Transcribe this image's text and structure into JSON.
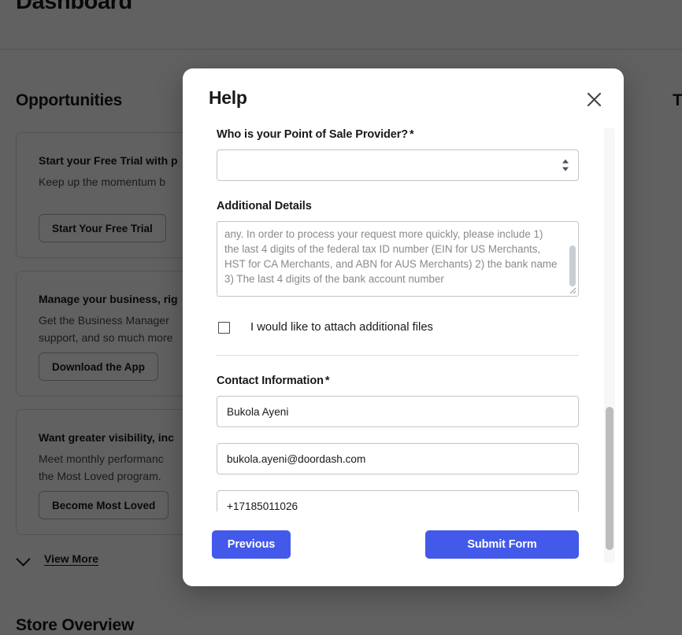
{
  "background": {
    "page_title": "Dashboard",
    "opportunities_heading": "Opportunities",
    "right_column_heading": "T",
    "store_overview_heading": "Store Overview",
    "view_more_label": "View More",
    "cards": [
      {
        "title": "Start your Free Trial with p",
        "description": "Keep up the momentum b",
        "button": "Start Your Free Trial"
      },
      {
        "title": "Manage your business, rig",
        "description": "Get the Business Manager\nsupport, and so much more",
        "button": "Download the App"
      },
      {
        "title": "Want greater visibility, inc",
        "description": "Meet monthly performanc\nthe Most Loved program.",
        "button": "Become Most Loved"
      }
    ]
  },
  "modal": {
    "title": "Help",
    "close_label": "×",
    "fields": {
      "pos_provider": {
        "label": "Who is your Point of Sale Provider?",
        "required_marker": "*",
        "value": "",
        "options": []
      },
      "additional_details": {
        "label": "Additional Details",
        "value": "any. In order to process your request more quickly, please include 1) the last 4 digits of the federal tax ID number (EIN for US Merchants, HST for CA Merchants, and ABN for AUS Merchants) 2) the bank name 3) The last 4 digits of the bank account number"
      },
      "attach_files": {
        "label": "I would like to attach additional files",
        "checked": false
      },
      "contact_information": {
        "label": "Contact Information",
        "required_marker": "*",
        "name": "Bukola Ayeni",
        "email": "bukola.ayeni@doordash.com",
        "phone": "+17185011026"
      }
    },
    "footer": {
      "previous_label": "Previous",
      "submit_label": "Submit Form"
    }
  },
  "colors": {
    "primary_blue": "#4259E9",
    "text_dark": "#191919",
    "placeholder_gray": "#8a8a8a",
    "border_gray": "#c4c4c4",
    "overlay": "rgba(0,0,0,0.62)"
  }
}
